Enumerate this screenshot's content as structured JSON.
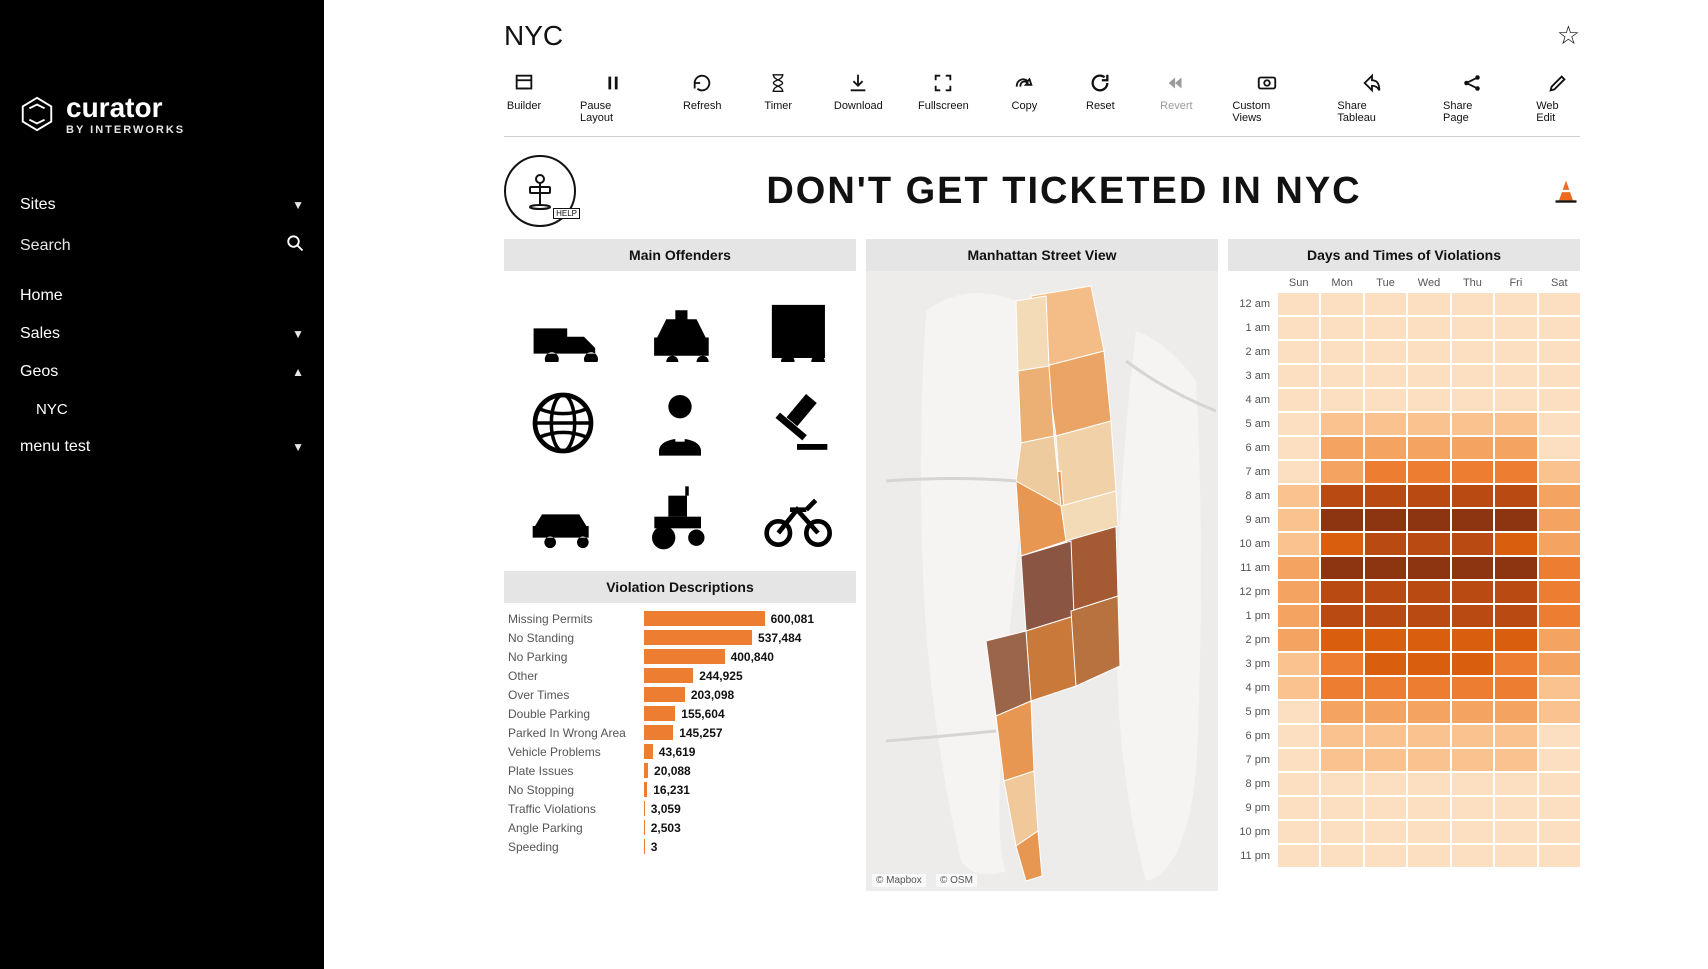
{
  "brand": {
    "name": "curator",
    "byline": "BY INTERWORKS"
  },
  "sidebar": {
    "sites_label": "Sites",
    "search_label": "Search",
    "items": [
      {
        "label": "Home",
        "has_caret": false
      },
      {
        "label": "Sales",
        "has_caret": true,
        "caret": "▼"
      },
      {
        "label": "Geos",
        "has_caret": true,
        "caret": "▲"
      },
      {
        "label": "NYC",
        "sub": true
      },
      {
        "label": "menu test",
        "has_caret": true,
        "caret": "▼"
      }
    ]
  },
  "page": {
    "title": "NYC",
    "banner": "DON'T GET TICKETED IN NYC",
    "help": "HELP"
  },
  "toolbar": [
    {
      "id": "builder",
      "label": "Builder"
    },
    {
      "id": "pause",
      "label": "Pause Layout"
    },
    {
      "id": "refresh",
      "label": "Refresh"
    },
    {
      "id": "timer",
      "label": "Timer"
    },
    {
      "id": "download",
      "label": "Download"
    },
    {
      "id": "fullscreen",
      "label": "Fullscreen"
    },
    {
      "id": "copy",
      "label": "Copy"
    },
    {
      "id": "reset",
      "label": "Reset"
    },
    {
      "id": "revert",
      "label": "Revert",
      "dim": true
    },
    {
      "id": "customviews",
      "label": "Custom Views"
    },
    {
      "id": "sharetableau",
      "label": "Share Tableau"
    },
    {
      "id": "sharepage",
      "label": "Share Page"
    },
    {
      "id": "webedit",
      "label": "Web Edit"
    }
  ],
  "panels": {
    "offenders_title": "Main Offenders",
    "violations_title": "Violation Descriptions",
    "map_title": "Manhattan Street View",
    "heat_title": "Days and Times of Violations",
    "map_credits": [
      "© Mapbox",
      "© OSM"
    ]
  },
  "offender_icons": [
    "truck",
    "taxi",
    "bus",
    "globe",
    "officer",
    "gavel",
    "car",
    "tractor",
    "motorcycle"
  ],
  "chart_data": {
    "violations": {
      "type": "bar",
      "title": "Violation Descriptions",
      "xlabel": "",
      "ylabel": "",
      "max": 600081,
      "categories": [
        "Missing Permits",
        "No Standing",
        "No Parking",
        "Other",
        "Over Times",
        "Double Parking",
        "Parked In Wrong Area",
        "Vehicle Problems",
        "Plate Issues",
        "No Stopping",
        "Traffic Violations",
        "Angle Parking",
        "Speeding"
      ],
      "values": [
        600081,
        537484,
        400840,
        244925,
        203098,
        155604,
        145257,
        43619,
        20088,
        16231,
        3059,
        2503,
        3
      ],
      "value_labels": [
        "600,081",
        "537,484",
        "400,840",
        "244,925",
        "203,098",
        "155,604",
        "145,257",
        "43,619",
        "20,088",
        "16,231",
        "3,059",
        "2,503",
        "3"
      ],
      "color": "#ed7d31"
    },
    "heatmap": {
      "type": "heatmap",
      "title": "Days and Times of Violations",
      "days": [
        "Sun",
        "Mon",
        "Tue",
        "Wed",
        "Thu",
        "Fri",
        "Sat"
      ],
      "hours": [
        "12 am",
        "1 am",
        "2 am",
        "3 am",
        "4 am",
        "5 am",
        "6 am",
        "7 am",
        "8 am",
        "9 am",
        "10 am",
        "11 am",
        "12 pm",
        "1 pm",
        "2 pm",
        "3 pm",
        "4 pm",
        "5 pm",
        "6 pm",
        "7 pm",
        "8 pm",
        "9 pm",
        "10 pm",
        "11 pm"
      ],
      "intensity": [
        [
          1,
          1,
          1,
          1,
          1,
          1,
          1
        ],
        [
          1,
          1,
          1,
          1,
          1,
          1,
          1
        ],
        [
          1,
          1,
          1,
          1,
          1,
          1,
          1
        ],
        [
          1,
          1,
          1,
          1,
          1,
          1,
          1
        ],
        [
          1,
          1,
          1,
          1,
          1,
          1,
          1
        ],
        [
          1,
          2,
          2,
          2,
          2,
          2,
          1
        ],
        [
          1,
          3,
          3,
          3,
          3,
          3,
          1
        ],
        [
          1,
          3,
          4,
          4,
          4,
          4,
          2
        ],
        [
          2,
          6,
          6,
          6,
          6,
          6,
          3
        ],
        [
          2,
          7,
          7,
          7,
          7,
          7,
          3
        ],
        [
          2,
          5,
          6,
          6,
          6,
          5,
          3
        ],
        [
          3,
          7,
          7,
          7,
          7,
          7,
          4
        ],
        [
          3,
          6,
          6,
          6,
          6,
          6,
          4
        ],
        [
          3,
          6,
          6,
          6,
          6,
          6,
          4
        ],
        [
          3,
          5,
          5,
          5,
          5,
          5,
          3
        ],
        [
          2,
          4,
          5,
          5,
          5,
          4,
          3
        ],
        [
          2,
          4,
          4,
          4,
          4,
          4,
          2
        ],
        [
          1,
          3,
          3,
          3,
          3,
          3,
          2
        ],
        [
          1,
          2,
          2,
          2,
          2,
          2,
          1
        ],
        [
          1,
          2,
          2,
          2,
          2,
          2,
          1
        ],
        [
          1,
          1,
          1,
          1,
          1,
          1,
          1
        ],
        [
          1,
          1,
          1,
          1,
          1,
          1,
          1
        ],
        [
          1,
          1,
          1,
          1,
          1,
          1,
          1
        ],
        [
          1,
          1,
          1,
          1,
          1,
          1,
          1
        ]
      ],
      "palette": [
        "#fcdfc0",
        "#fac28e",
        "#f4a460",
        "#ed7d31",
        "#d95f0e",
        "#b84a12",
        "#8c3510"
      ],
      "scale_note": "intensity values 1–7 index into palette"
    },
    "map": {
      "type": "area",
      "title": "Manhattan Street View",
      "note": "choropleth of Manhattan neighborhoods; darker = more violations",
      "palette": [
        "#fcdfc0",
        "#f4bd88",
        "#e89752",
        "#c97a3a",
        "#a45a32",
        "#8a5543"
      ]
    }
  }
}
